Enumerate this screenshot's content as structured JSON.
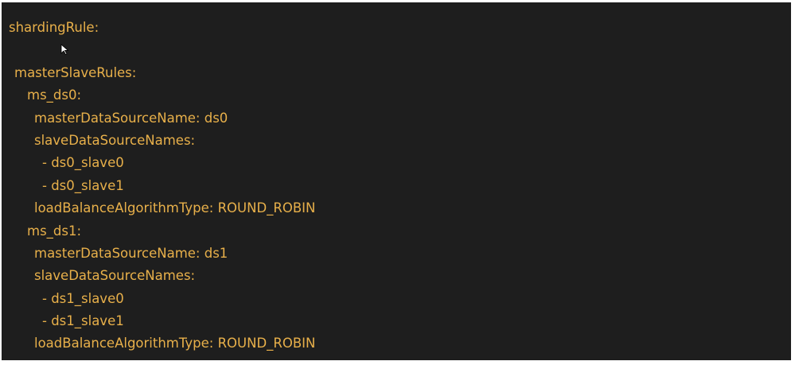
{
  "editor": {
    "theme_bg": "#1e1e1e",
    "text_color": "#e8b04a",
    "lines": [
      {
        "indent": 0,
        "text": "shardingRule:"
      },
      {
        "indent": 0,
        "text": ""
      },
      {
        "indent": 1,
        "text": "masterSlaveRules:"
      },
      {
        "indent": 2,
        "text": "ms_ds0:"
      },
      {
        "indent": 3,
        "text": "masterDataSourceName: ds0"
      },
      {
        "indent": 3,
        "text": "slaveDataSourceNames:"
      },
      {
        "indent": 4,
        "text": "- ds0_slave0"
      },
      {
        "indent": 4,
        "text": "- ds0_slave1"
      },
      {
        "indent": 3,
        "text": "loadBalanceAlgorithmType: ROUND_ROBIN"
      },
      {
        "indent": 2,
        "text": "ms_ds1:"
      },
      {
        "indent": 3,
        "text": "masterDataSourceName: ds1"
      },
      {
        "indent": 3,
        "text": "slaveDataSourceNames:"
      },
      {
        "indent": 4,
        "text": "- ds1_slave0"
      },
      {
        "indent": 4,
        "text": "- ds1_slave1"
      },
      {
        "indent": 3,
        "text": "loadBalanceAlgorithmType: ROUND_ROBIN"
      }
    ]
  },
  "cursor": {
    "icon": "mouse-pointer-icon"
  }
}
